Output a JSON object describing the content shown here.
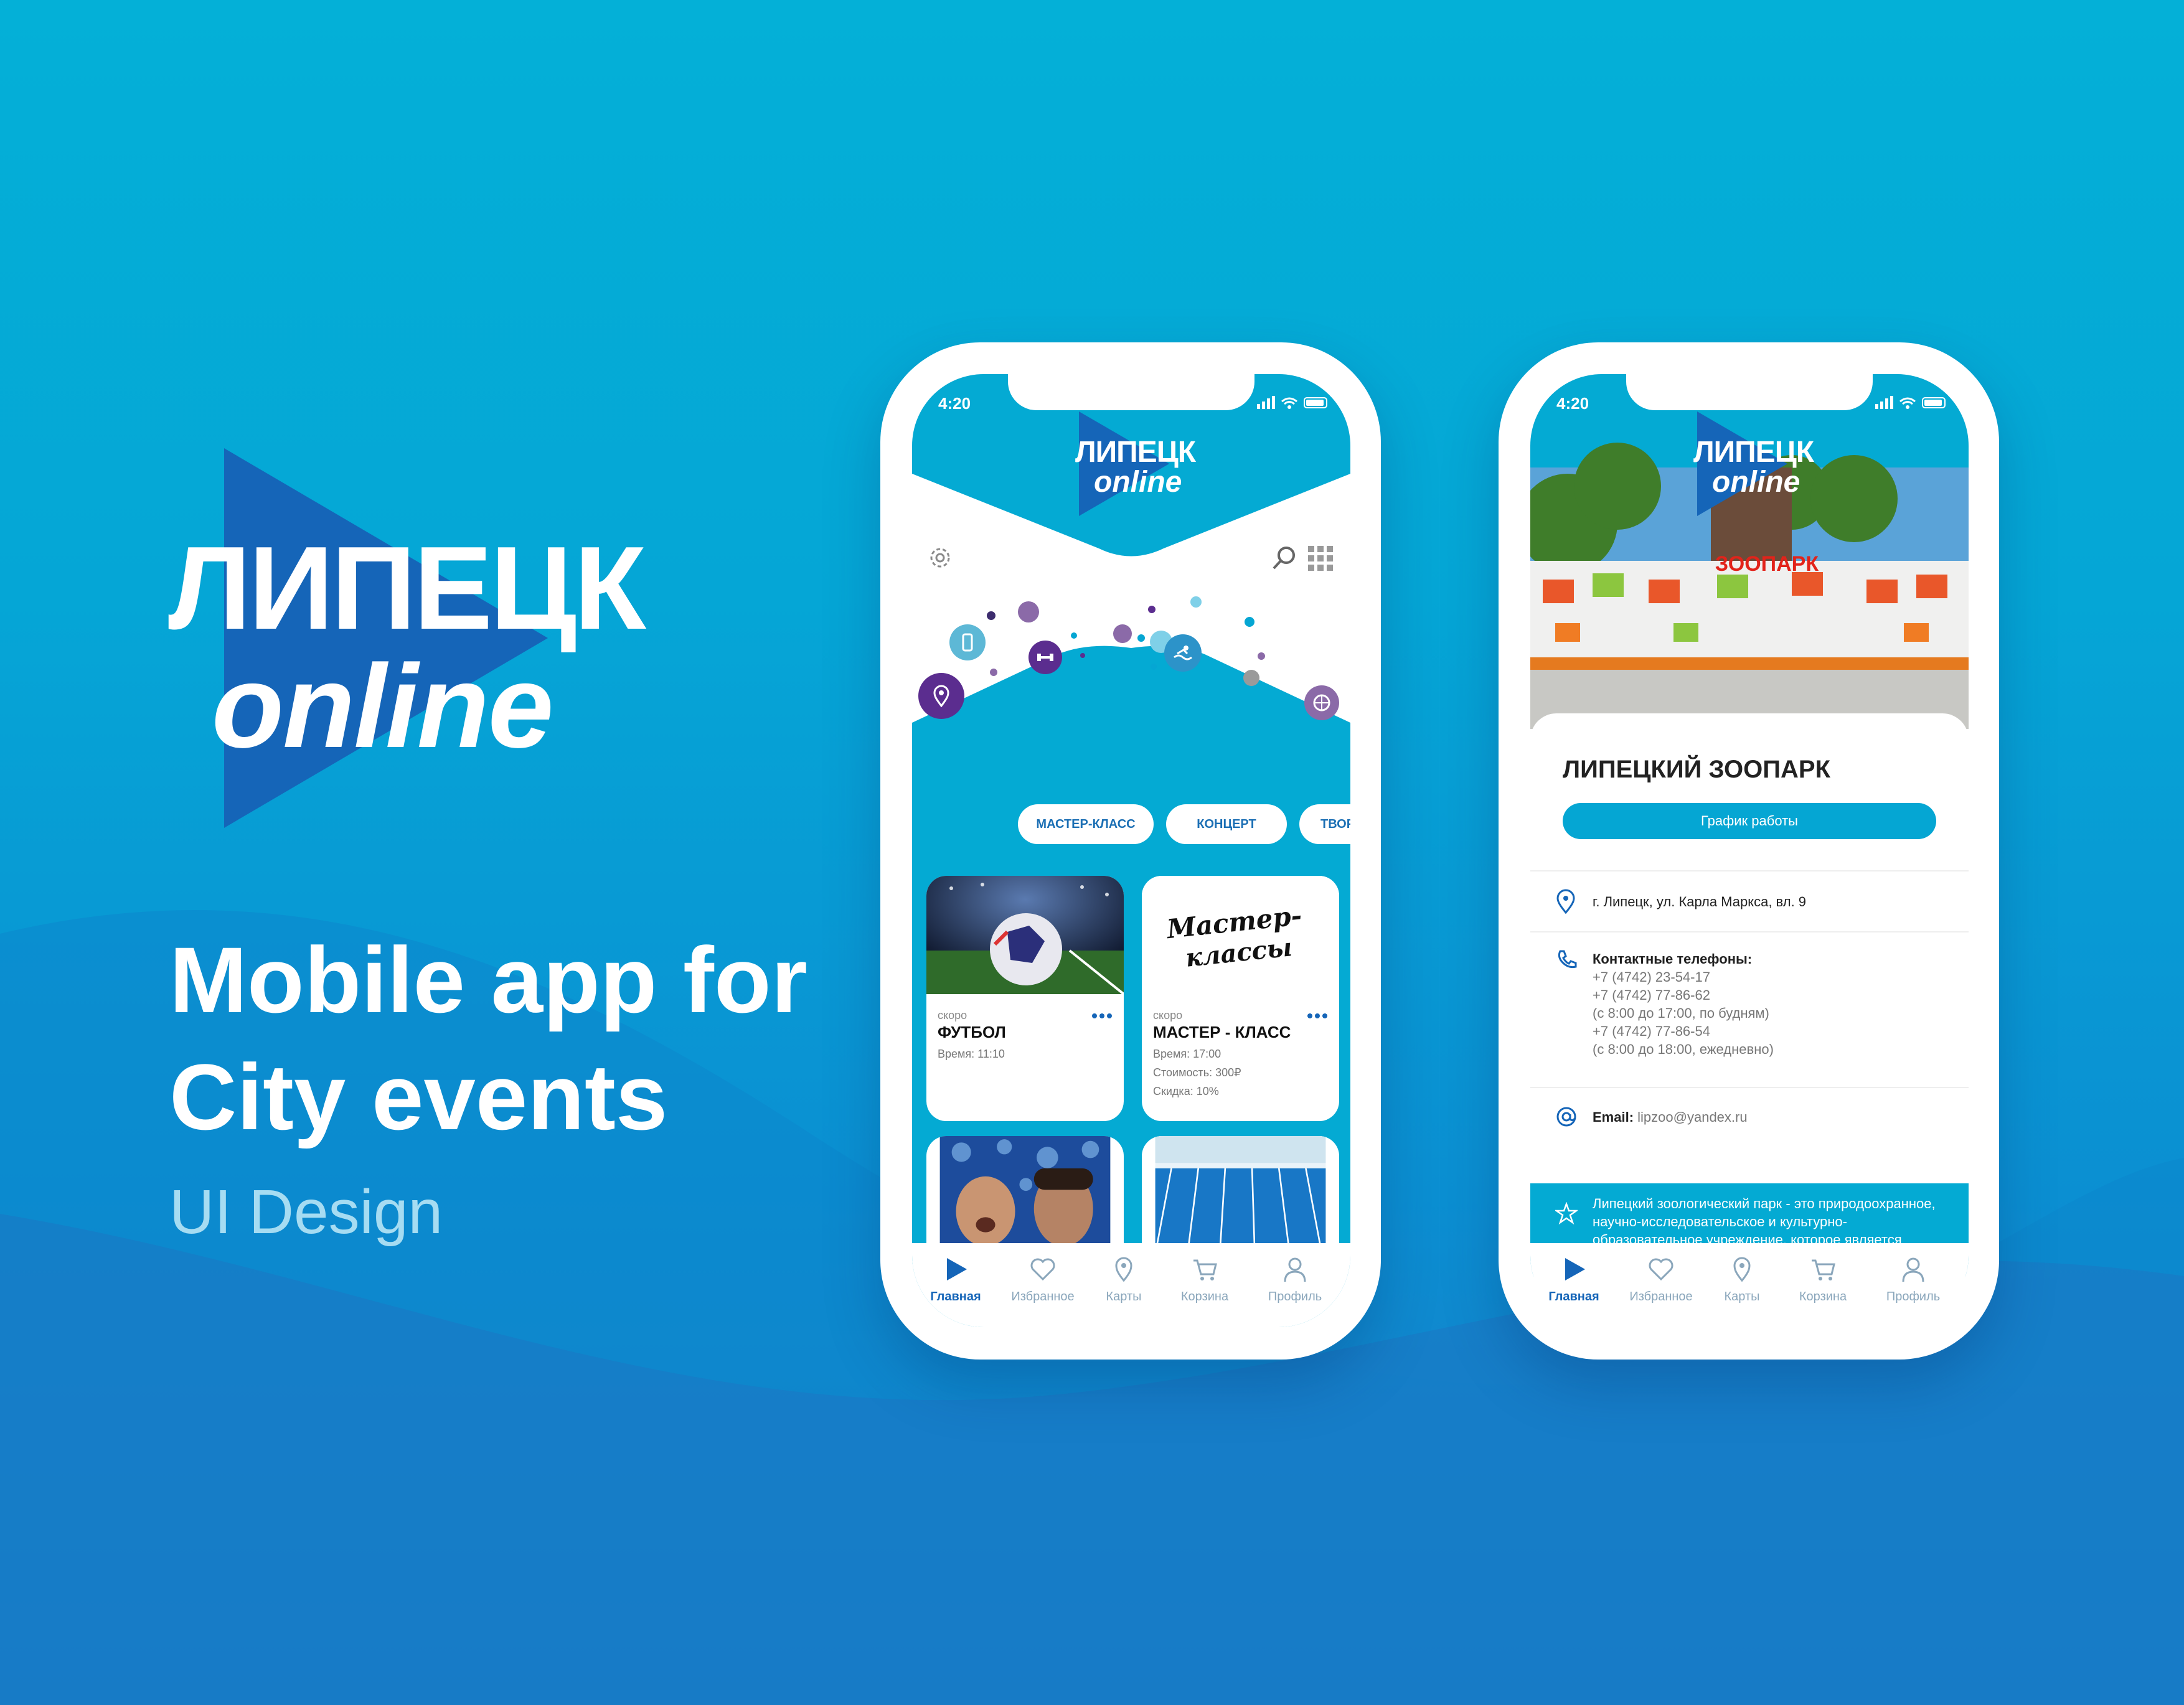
{
  "hero": {
    "logo_word1": "ЛИПЕЦК",
    "logo_word2": "online",
    "headline_line1": "Mobile app for",
    "headline_line2": "City events",
    "subtitle": "UI Design"
  },
  "colors": {
    "accent": "#04aad3",
    "brand_blue": "#1565b8",
    "purple": "#5b2d8f"
  },
  "phone1": {
    "status_time": "4:20",
    "logo_word1": "ЛИПЕЦК",
    "logo_word2": "online",
    "chips": [
      "МАСТЕР-КЛАСС",
      "КОНЦЕРТ",
      "ТВОР"
    ],
    "cards": [
      {
        "soon": "скоро",
        "title": "ФУТБОЛ",
        "meta1": "Время: 11:10"
      },
      {
        "soon": "скоро",
        "title": "МАСТЕР - КЛАСС",
        "meta1": "Время: 17:00",
        "meta2": "Стоимость: 300₽",
        "meta3": "Скидка: 10%",
        "image_text_1": "Мастер-",
        "image_text_2": "классы"
      }
    ],
    "nav": [
      "Главная",
      "Избранное",
      "Карты",
      "Корзина",
      "Профиль"
    ]
  },
  "phone2": {
    "status_time": "4:20",
    "logo_word1": "ЛИПЕЦК",
    "logo_word2": "online",
    "sign_text": "ЗООПАРК",
    "title": "ЛИПЕЦКИЙ ЗООПАРК",
    "schedule_button": "График работы",
    "address": "г. Липецк, ул. Карла Маркса, вл. 9",
    "phones_label": "Контактные телефоны:",
    "phones": [
      "+7 (4742) 23-54-17",
      "+7 (4742) 77-86-62",
      "(с 8:00 до 17:00, по будням)",
      "+7 (4742) 77-86-54",
      "(с 8:00 до 18:00, ежедневно)"
    ],
    "email_label": "Email:",
    "email": "lipzoo@yandex.ru",
    "about": "Липецкий зоологический парк - это природоохранное, научно-исследовательское и культурно-образовательное учреждение, которое является искусственно созданным",
    "nav": [
      "Главная",
      "Избранное",
      "Карты",
      "Корзина",
      "Профиль"
    ]
  }
}
